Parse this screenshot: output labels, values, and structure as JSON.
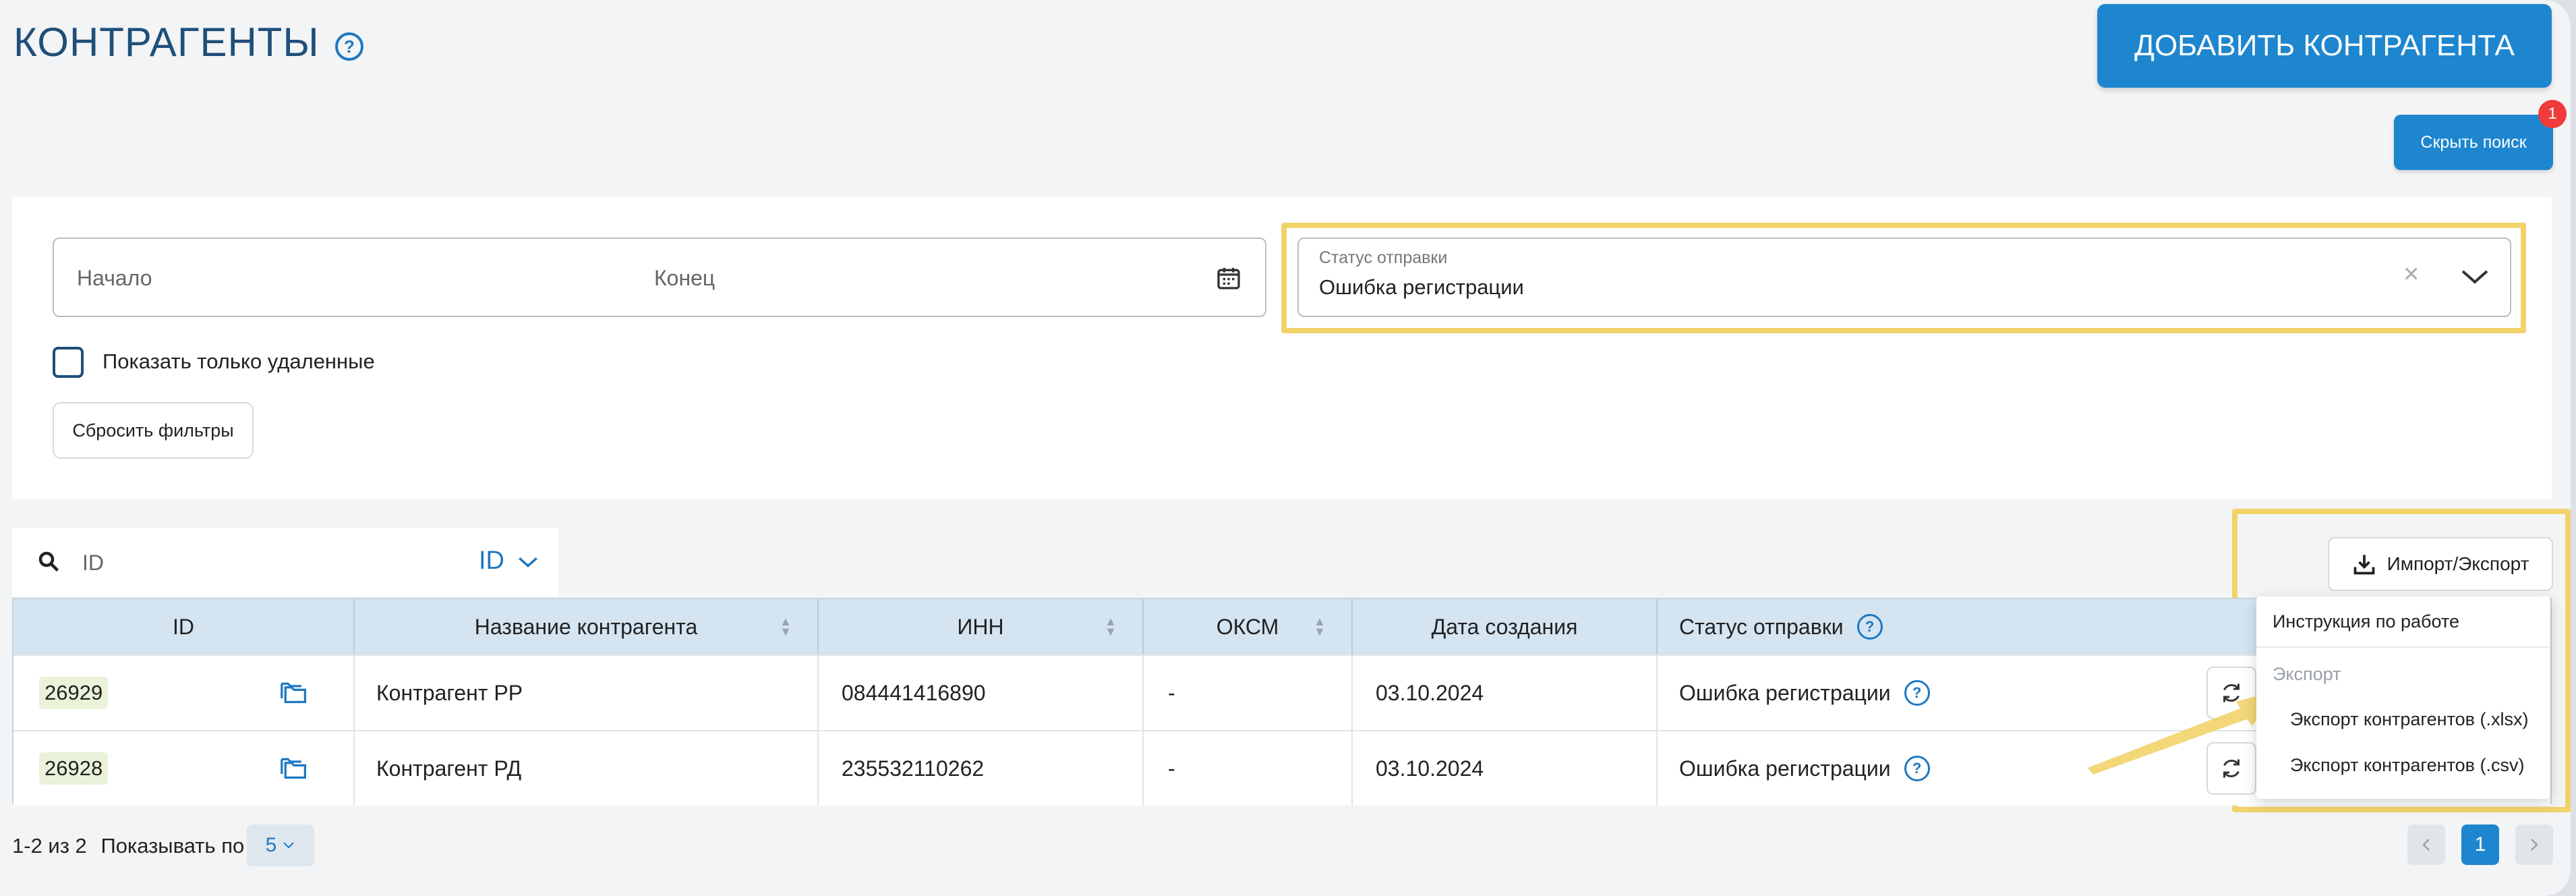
{
  "header": {
    "title": "КОНТРАГЕНТЫ",
    "help_icon": "question-circle-icon",
    "add_button": "ДОБАВИТЬ КОНТРАГЕНТА"
  },
  "search_toggle": {
    "label": "Скрыть поиск",
    "badge": "1"
  },
  "filters": {
    "date_start_placeholder": "Начало",
    "date_end_placeholder": "Конец",
    "status_label": "Статус отправки",
    "status_value": "Ошибка регистрации",
    "status_clear": "×",
    "show_deleted_label": "Показать только удаленные",
    "reset_label": "Сбросить фильтры"
  },
  "search": {
    "placeholder": "ID",
    "field_selector": "ID"
  },
  "import_export": {
    "label": "Импорт/Экспорт"
  },
  "table": {
    "columns": [
      "ID",
      "Название контрагента",
      "ИНН",
      "ОКСМ",
      "Дата создания",
      "Статус отправки"
    ],
    "rows": [
      {
        "id": "26929",
        "name": "Контрагент РР",
        "inn": "084441416890",
        "oksm": "-",
        "date": "03.10.2024",
        "status": "Ошибка регистрации"
      },
      {
        "id": "26928",
        "name": "Контрагент РД",
        "inn": "235532110262",
        "oksm": "-",
        "date": "03.10.2024",
        "status": "Ошибка регистрации"
      }
    ]
  },
  "dropdown": {
    "instruction": "Инструкция по работе",
    "section": "Экспорт",
    "export_xlsx": "Экспорт контрагентов (.xlsx)",
    "export_csv": "Экспорт контрагентов (.csv)"
  },
  "pagination": {
    "range": "1-2 из 2",
    "per_page_label": "Показывать по",
    "per_page": "5",
    "current_page": "1"
  },
  "colors": {
    "primary": "#1d86cf",
    "title": "#1f4f7a",
    "header_row": "#d4e4f1",
    "highlight": "#f2d36a",
    "badge": "#ef3b3b"
  }
}
